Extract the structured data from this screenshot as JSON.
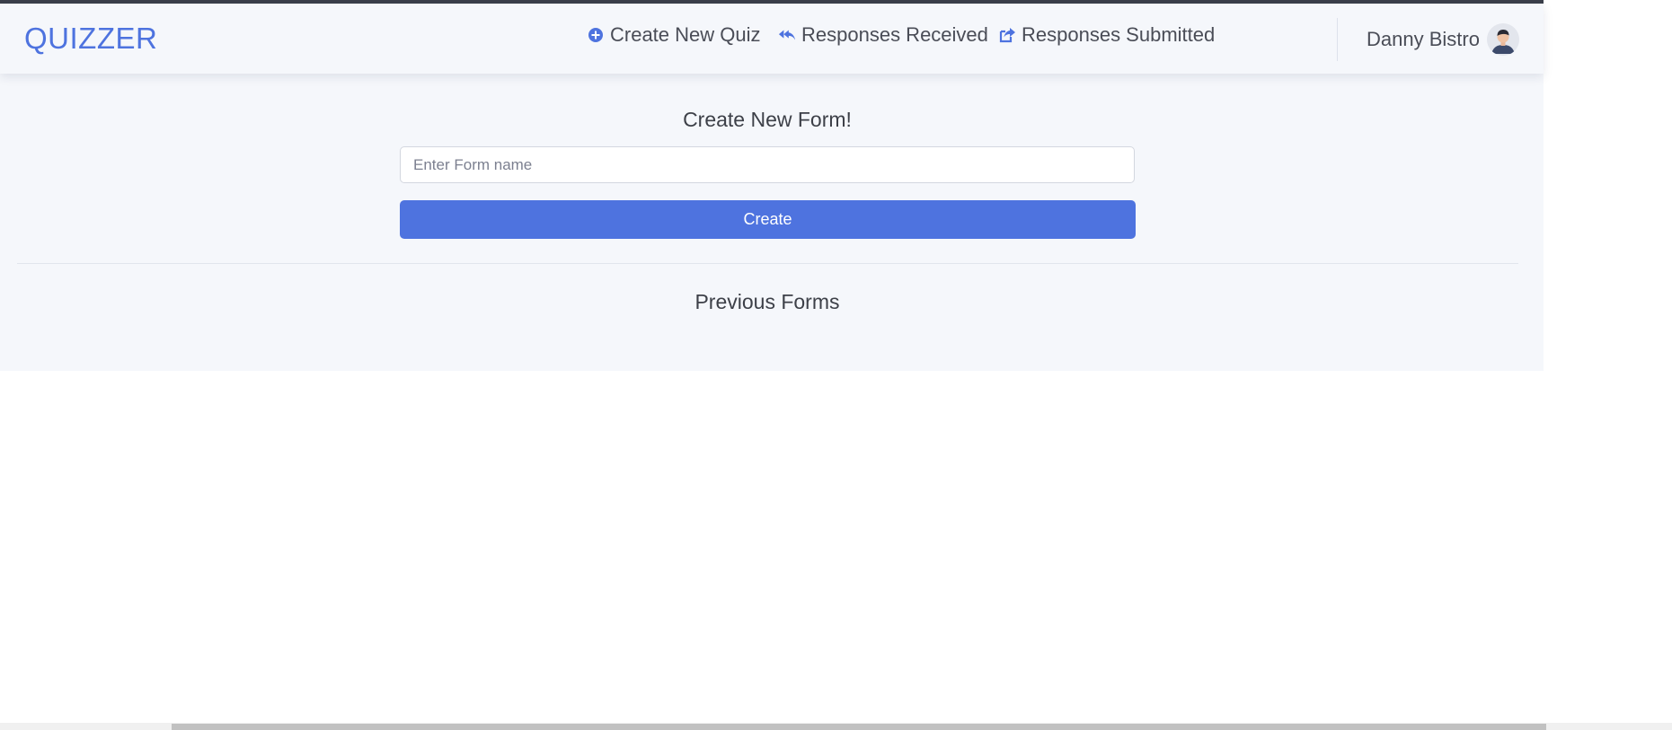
{
  "navbar": {
    "brand": "QUIZZER",
    "items": [
      {
        "label": "Create New Quiz",
        "icon": "plus-circle-icon"
      },
      {
        "label": "Responses Received",
        "icon": "reply-all-icon"
      },
      {
        "label": "Responses Submitted",
        "icon": "share-square-icon"
      }
    ],
    "user": {
      "name": "Danny Bistro",
      "avatar": "user-avatar-icon"
    }
  },
  "main": {
    "create_title": "Create New Form!",
    "form_name_placeholder": "Enter Form name",
    "form_name_value": "",
    "create_button": "Create",
    "previous_title": "Previous Forms",
    "previous_forms": []
  },
  "colors": {
    "accent": "#4e73df",
    "background": "#f5f7fb",
    "text": "#3d4048"
  }
}
